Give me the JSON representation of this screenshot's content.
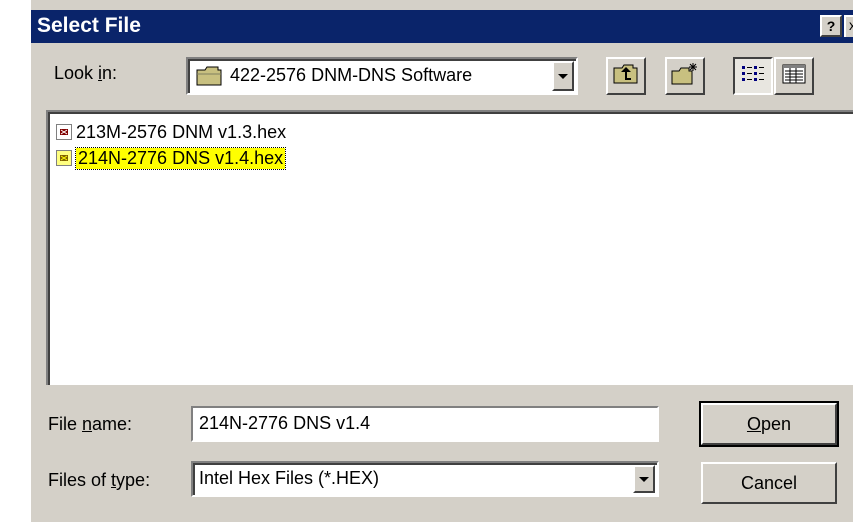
{
  "dialog": {
    "title": "Select File",
    "help_glyph": "?",
    "close_glyph": "x"
  },
  "look_in": {
    "label_pre": "Look ",
    "label_accel": "i",
    "label_post": "n:",
    "value": "422-2576 DNM-DNS Software",
    "icon": "folder-icon"
  },
  "toolbar": {
    "up_icon": "up-one-level-icon",
    "new_folder_icon": "new-folder-icon",
    "list_icon": "list-view-icon",
    "details_icon": "details-view-icon"
  },
  "files": [
    {
      "name": "213M-2576 DNM v1.3.hex",
      "selected": false,
      "icon": "hex-file-icon"
    },
    {
      "name": "214N-2776 DNS v1.4.hex",
      "selected": true,
      "icon": "hex-file-icon"
    }
  ],
  "file_name": {
    "label_pre": "File ",
    "label_accel": "n",
    "label_post": "ame:",
    "value": "214N-2776 DNS v1.4"
  },
  "file_type": {
    "label_pre": "Files of ",
    "label_accel": "t",
    "label_post": "ype:",
    "value": "Intel Hex Files (*.HEX)"
  },
  "buttons": {
    "open": "Open",
    "cancel": "Cancel"
  },
  "colors": {
    "titlebar": "#0a246a",
    "face": "#d4d0c8",
    "selection_highlight": "#ffff00"
  }
}
